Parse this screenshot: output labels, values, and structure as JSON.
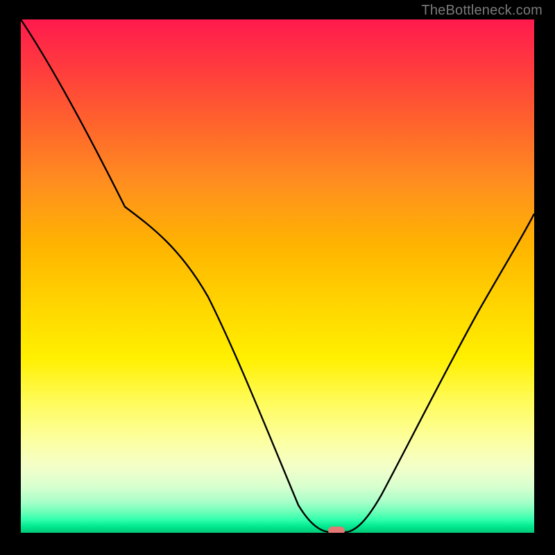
{
  "watermark": "TheBottleneck.com",
  "chart_data": {
    "type": "line",
    "title": "",
    "xlabel": "",
    "ylabel": "",
    "xlim": [
      0,
      100
    ],
    "ylim": [
      0,
      100
    ],
    "grid": false,
    "legend": false,
    "annotations": [],
    "background_gradient": {
      "orientation": "vertical",
      "stops": [
        {
          "pos": 0,
          "color": "#ff1a4d"
        },
        {
          "pos": 50,
          "color": "#ffd600"
        },
        {
          "pos": 100,
          "color": "#00c877"
        }
      ]
    },
    "series": [
      {
        "name": "bottleneck-curve",
        "x": [
          0,
          5,
          10,
          15,
          20,
          25,
          30,
          35,
          40,
          45,
          50,
          55,
          58,
          60,
          62,
          64,
          66,
          70,
          75,
          80,
          85,
          90,
          95,
          100
        ],
        "y": [
          100,
          93,
          86,
          79,
          72,
          66,
          62,
          56,
          46,
          34,
          22,
          10,
          3,
          1,
          0,
          0,
          2,
          9,
          19,
          30,
          40,
          49,
          56,
          62
        ]
      }
    ],
    "marker": {
      "x": 62,
      "y": 0,
      "color": "#e27a73",
      "shape": "pill"
    }
  }
}
